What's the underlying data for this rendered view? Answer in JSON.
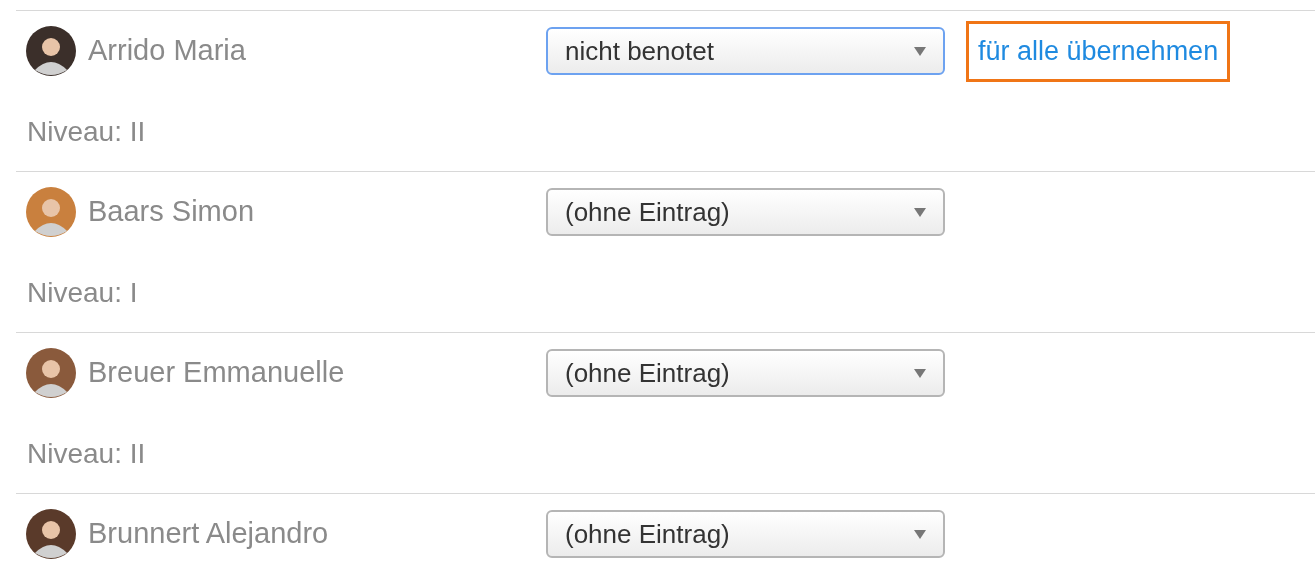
{
  "students": [
    {
      "name": "Arrido Maria",
      "grade": {
        "value": "nicht benotet",
        "focused": true
      },
      "apply_all": {
        "label": "für alle übernehmen",
        "highlighted": true
      },
      "niveau": "Niveau: II"
    },
    {
      "name": "Baars Simon",
      "grade": {
        "value": "(ohne Eintrag)",
        "focused": false
      },
      "niveau": "Niveau: I"
    },
    {
      "name": "Breuer Emmanuelle",
      "grade": {
        "value": "(ohne Eintrag)",
        "focused": false
      },
      "niveau": "Niveau: II"
    },
    {
      "name": "Brunnert Alejandro",
      "grade": {
        "value": "(ohne Eintrag)",
        "focused": false
      }
    }
  ]
}
